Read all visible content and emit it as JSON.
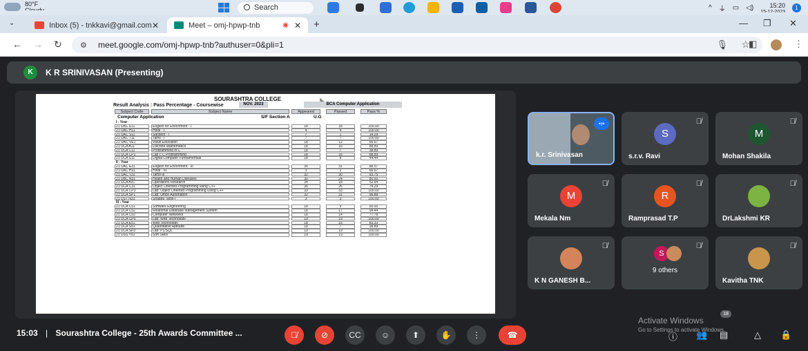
{
  "taskbar": {
    "weather_temp": "80°F",
    "weather_desc": "Cloudy",
    "search_label": "Search",
    "time": "15:20",
    "date": "15-12-2023",
    "notification_count": "1"
  },
  "tabs": [
    {
      "label": "Inbox (5) - tnkkavi@gmail.com",
      "active": false
    },
    {
      "label": "Meet – omj-hpwp-tnb",
      "active": true
    }
  ],
  "address": {
    "url": "meet.google.com/omj-hpwp-tnb?authuser=0&pli=1"
  },
  "presenter": {
    "initial": "K",
    "name": "K R SRINIVASAN (Presenting)"
  },
  "document": {
    "college": "SOURASHTRA COLLEGE",
    "title": "Result Analysis : Pass Percentage - Coursewise",
    "month": "NOV. 2023",
    "department": "BCA Computer Application",
    "headers": [
      "Subject Code",
      "Subject Name",
      "Appeared",
      "Passed",
      "Pass %"
    ],
    "course": "Computer Application",
    "section": "S/F Section A",
    "level": "U.G",
    "years": [
      {
        "label": "I - Year",
        "rows": [
          [
            "21 UAC E11",
            "English for Enrichment - I",
            "18",
            "18",
            "100.00"
          ],
          [
            "21 UAC H11",
            "Hindi - I",
            "4",
            "4",
            "100.00"
          ],
          [
            "21 UAC S11",
            "Sanskrit - I",
            "7",
            "1",
            "14.29"
          ],
          [
            "21 UAC T11",
            "Tamil - I",
            "7",
            "7",
            "100.00"
          ],
          [
            "21 UAC VE1",
            "Value Education",
            "18",
            "12",
            "66.67"
          ],
          [
            "21 UCA A11",
            "Discrete Mathematics",
            "18",
            "16",
            "88.89"
          ],
          [
            "21 UCA C11",
            "Programming in C",
            "18",
            "7",
            "38.89"
          ],
          [
            "21 UCA CP1",
            "Lab I: C Programming",
            "18",
            "16",
            "88.89"
          ],
          [
            "21 UCA S11",
            "Digital Computer Fundamentals",
            "18",
            "8",
            "44.44"
          ]
        ]
      },
      {
        "label": "II - Year",
        "rows": [
          [
            "21 UAC E31",
            "English for Enrichment - III",
            "35",
            "31",
            "88.57"
          ],
          [
            "21 UAC H31",
            "Hindi - III",
            "3",
            "2",
            "66.67"
          ],
          [
            "21 UAC T31",
            "Tamil-III",
            "32",
            "30",
            "93.75"
          ],
          [
            "21 UBC N31",
            "Health and Human Diseases",
            "30",
            "24",
            "80.00"
          ],
          [
            "21 UCA A31",
            "Operations Research",
            "34",
            "18",
            "52.94"
          ],
          [
            "21 UCA C31",
            "Object Oriented Programming using C++",
            "35",
            "26",
            "74.29"
          ],
          [
            "21 UCA CP3",
            "Lab: Object Oriented Programming Using C++",
            "33",
            "33",
            "100.00"
          ],
          [
            "21 UCA SP1",
            "Lab: Office Automation",
            "32",
            "31",
            "96.88"
          ],
          [
            "21 UST N31",
            "Sirappu Tamil-I",
            "3",
            "3",
            "100.00"
          ]
        ]
      },
      {
        "label": "III - Year",
        "rows": [
          [
            "21 UCA C51",
            "Software Engineering",
            "18",
            "9",
            "50.00"
          ],
          [
            "21 UCA C52",
            "Relational Database Management System",
            "18",
            "17",
            "94.44"
          ],
          [
            "21 UCA C53",
            "Computer Networks",
            "18",
            "14",
            "77.78"
          ],
          [
            "21 UCA CP5",
            "Lab: Web Technology",
            "19",
            "19",
            "100.00"
          ],
          [
            "21 UCA E51",
            "Web Technology",
            "18",
            "15",
            "83.33"
          ],
          [
            "21 UCA S51",
            "Quantitative Aptitude",
            "18",
            "7",
            "38.89"
          ],
          [
            "21 UCA SP3",
            "Lab: PL/SQL",
            "19",
            "19",
            "100.00"
          ],
          [
            "21 USS Y51",
            "Soft Skills",
            "19",
            "19",
            "100.00"
          ]
        ]
      }
    ]
  },
  "participants": [
    {
      "name": "k.r. Srinivasan",
      "type": "video"
    },
    {
      "name": "s.r.v. Ravi",
      "initial": "S",
      "color": "#5c6bc0",
      "type": "avatar"
    },
    {
      "name": "Mohan Shakila",
      "initial": "M",
      "color": "#1e5631",
      "type": "avatar"
    },
    {
      "name": "Mekala Nm",
      "initial": "M",
      "color": "#ea4335",
      "type": "avatar"
    },
    {
      "name": "Ramprasad T.P",
      "initial": "R",
      "color": "#e8541e",
      "type": "avatar"
    },
    {
      "name": "DrLakshmi KR",
      "type": "photo",
      "color": "#7cb342"
    },
    {
      "name": "K N GANESH B...",
      "type": "photo",
      "color": "#d4845a"
    },
    {
      "name": "9 others",
      "initial": "S",
      "color": "#c2185b",
      "type": "others"
    },
    {
      "name": "Kavitha TNK",
      "type": "photo",
      "color": "#c9954c"
    }
  ],
  "bottom": {
    "time": "15:03",
    "separator": "|",
    "meeting_name": "Sourashtra College - 25th Awards Committee ...",
    "participant_count": "18"
  },
  "watermark": {
    "line1": "Activate Windows",
    "line2": "Go to Settings to activate Windows."
  },
  "colors": {
    "meet_bg": "#202124",
    "tile_bg": "#3c4043",
    "end_call": "#ea4335",
    "accent": "#1a73e8"
  }
}
